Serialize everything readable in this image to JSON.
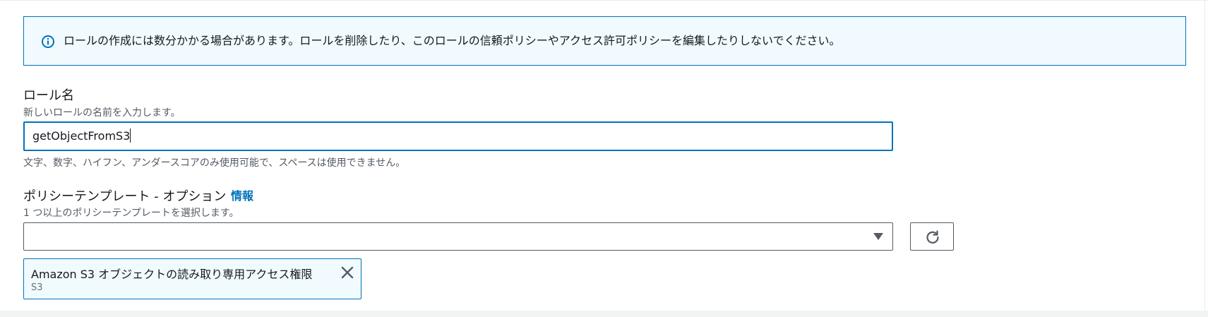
{
  "alert": {
    "icon": "info-circle-icon",
    "message": "ロールの作成には数分かかる場合があります。ロールを削除したり、このロールの信頼ポリシーやアクセス許可ポリシーを編集したりしないでください。"
  },
  "role_name": {
    "label": "ロール名",
    "description": "新しいロールの名前を入力します。",
    "value": "getObjectFromS3",
    "constraint": "文字、数字、ハイフン、アンダースコアのみ使用可能で、スペースは使用できません。"
  },
  "policy_templates": {
    "label": "ポリシーテンプレート - オプション",
    "info_link": "情報",
    "description": "1 つ以上のポリシーテンプレートを選択します。",
    "select_value": "",
    "selected": [
      {
        "label": "Amazon S3 オブジェクトの読み取り専用アクセス権限",
        "sublabel": "S3"
      }
    ]
  },
  "colors": {
    "accent": "#0073bb",
    "alert_bg": "#f1faff",
    "text": "#16191f",
    "secondary_text": "#545b64"
  }
}
